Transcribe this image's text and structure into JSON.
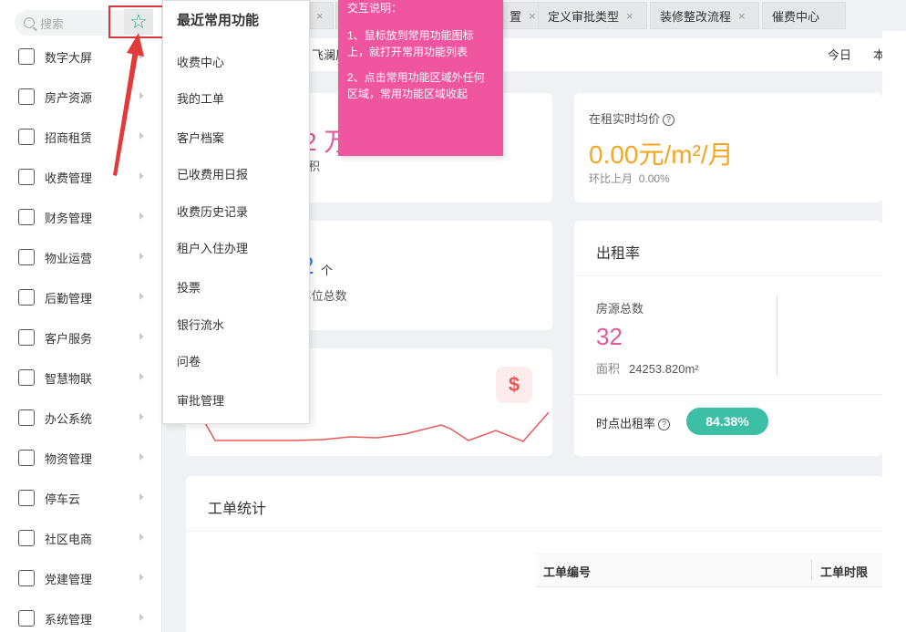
{
  "sidebar": {
    "search_placeholder": "搜索",
    "items": [
      {
        "label": "数字大屏",
        "icon": "monitor-icon"
      },
      {
        "label": "房产资源",
        "icon": "building-icon"
      },
      {
        "label": "招商租赁",
        "icon": "house-lease-icon"
      },
      {
        "label": "收费管理",
        "icon": "money-bag-icon"
      },
      {
        "label": "财务管理",
        "icon": "finance-icon"
      },
      {
        "label": "物业运营",
        "icon": "property-ops-icon"
      },
      {
        "label": "后勤管理",
        "icon": "logistics-icon"
      },
      {
        "label": "客户服务",
        "icon": "customer-service-icon"
      },
      {
        "label": "智慧物联",
        "icon": "iot-icon"
      },
      {
        "label": "办公系统",
        "icon": "briefcase-icon"
      },
      {
        "label": "物资管理",
        "icon": "warehouse-icon"
      },
      {
        "label": "停车云",
        "icon": "parking-icon"
      },
      {
        "label": "社区电商",
        "icon": "shopping-bag-icon"
      },
      {
        "label": "党建管理",
        "icon": "party-icon"
      },
      {
        "label": "系统管理",
        "icon": "gear-icon"
      }
    ]
  },
  "favorites": {
    "title": "最近常用功能",
    "items": [
      "收费中心",
      "我的工单",
      "客户档案",
      "已收费用日报",
      "收费历史记录",
      "租户入住办理",
      "投票",
      "银行流水",
      "问卷",
      "审批管理"
    ]
  },
  "tooltip": {
    "title": "交互说明：",
    "line1": "1、鼠标放到常用功能图标上，就打开常用功能列表",
    "line2": "2、点击常用功能区域外任何区域，常用功能区域收起"
  },
  "tabs": [
    {
      "label": "定义审批类型"
    },
    {
      "label": "装修整改流程"
    },
    {
      "label": "催费中心"
    }
  ],
  "tab_partial": "置",
  "toolbar": {
    "location": "飞澜居",
    "today": "今日",
    "this": "本"
  },
  "cards": {
    "partial_big": "2 万",
    "partial_unit": "积",
    "partial_count": "2",
    "partial_count_unit": "个",
    "partial_count_label": "位/车位总数"
  },
  "rent_price": {
    "label": "在租实时均价",
    "value": "0.00元/m²/月",
    "sub_label": "环比上月",
    "sub_value": "0.00%"
  },
  "occupancy": {
    "title": "出租率",
    "total_label": "房源总数",
    "total_value": "32",
    "area_label": "面积",
    "area_value": "24253.820m²",
    "rate_label": "时点出租率",
    "rate_value": "84.38%"
  },
  "work_orders": {
    "title": "工单统计",
    "col1": "工单编号",
    "col2": "工单时限"
  },
  "colors": {
    "accent_pink": "#f056a0",
    "rate_green": "#3dbfa6",
    "highlight_red": "#d9363e",
    "rent_orange": "#f5a623"
  }
}
